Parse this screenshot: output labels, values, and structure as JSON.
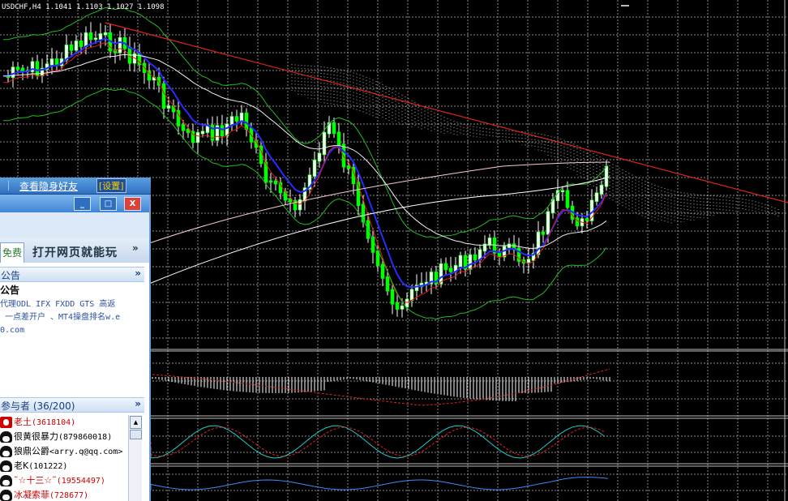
{
  "chart": {
    "symbol_header": "USDCHF,H4  1.1041 1.1103 1.1027 1.1098",
    "colors": {
      "background": "#000000",
      "grid": "#c8c8c8",
      "bull_candle": "#ffffff",
      "bear_candle": "#00ff00",
      "trendline": "#dd2222",
      "ma_blue": "#2a2aff",
      "ma_red": "#e01818",
      "bands": "#22bb22",
      "macd_signal": "#dd2222",
      "stoch_main": "#22cccc",
      "rsi": "#3a8cff"
    }
  },
  "chart_data": {
    "type": "candlestick",
    "title": "USDCHF,H4",
    "last_bar": {
      "open": 1.1041,
      "high": 1.1103,
      "low": 1.1027,
      "close": 1.1098
    },
    "panes": [
      "price",
      "macd",
      "stochastic",
      "rsi"
    ]
  },
  "chat": {
    "hidden_friends_link": "查看隐身好友",
    "settings_label": "[设置]",
    "window_buttons": {
      "minimize": "_",
      "maximize": "□",
      "close": "X"
    },
    "tabs": {
      "free": "免费",
      "web": "打开网页就能玩",
      "more": "»"
    },
    "announcement_section": "公告",
    "announcement_collapse": "»",
    "announcement": {
      "heading": "公告",
      "line1": "代理ODL IFX FXDD GTS 高返",
      "line2": "一点差开户 、MT4操盘排名w.e",
      "line3": "0.com"
    },
    "participants_section": "参与者 (36/200)",
    "participants_collapse": "»",
    "participants": [
      {
        "name": "老土",
        "id": "(3618104)",
        "color": "#cc0000"
      },
      {
        "name": "很黄很暴力",
        "id": "(879860018)",
        "color": "#000000"
      },
      {
        "name": "狼鼎公爵",
        "id": "<arry.q@qq.com>",
        "color": "#000000"
      },
      {
        "name": "老K",
        "id": "(101222)",
        "color": "#000000"
      },
      {
        "name": "˜☆十三☆˜",
        "id": "(19554497)",
        "color": "#cc0000"
      },
      {
        "name": "冰凝索菲",
        "id": "(728677)",
        "color": "#cc0000"
      }
    ]
  }
}
